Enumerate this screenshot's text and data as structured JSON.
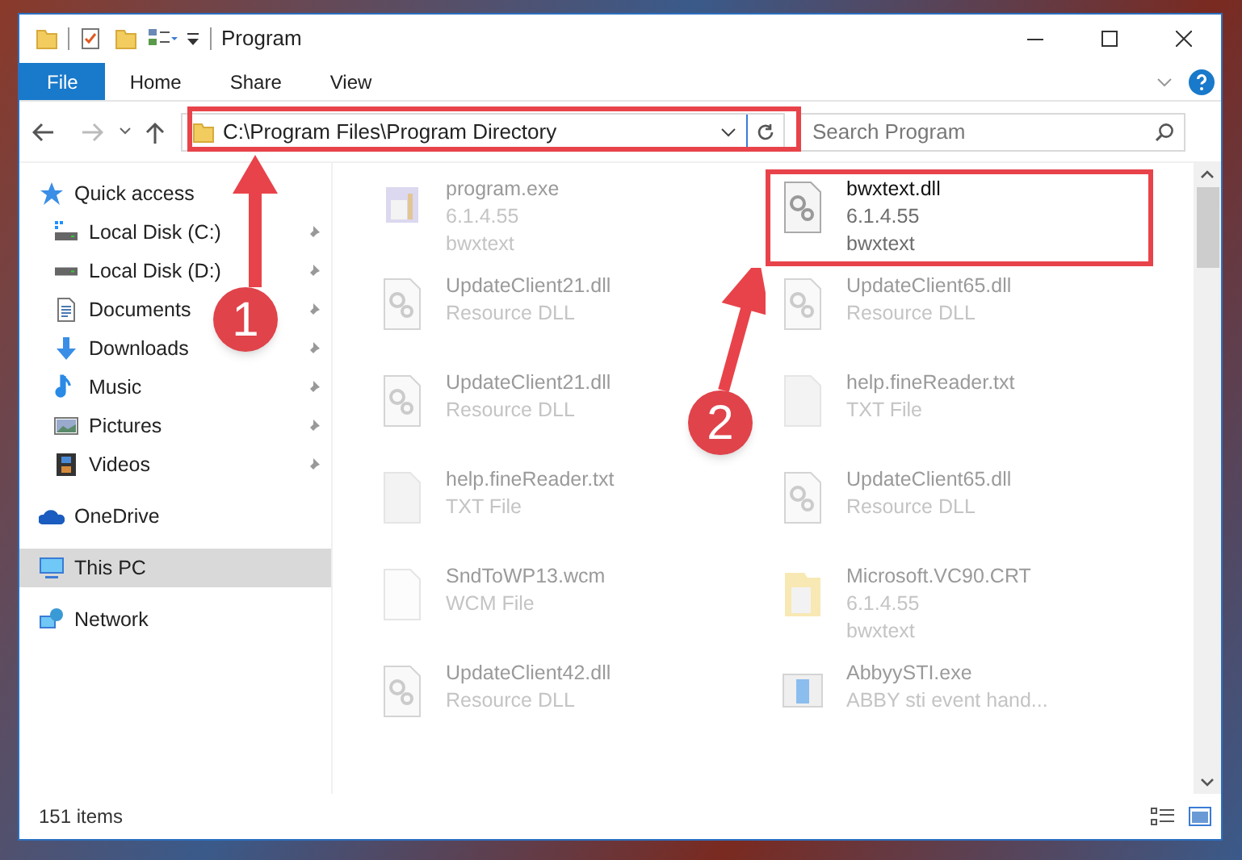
{
  "window": {
    "title": "Program"
  },
  "ribbon_tabs": [
    {
      "label": "File",
      "selected": true
    },
    {
      "label": "Home",
      "selected": false
    },
    {
      "label": "Share",
      "selected": false
    },
    {
      "label": "View",
      "selected": false
    }
  ],
  "address": "C:\\Program Files\\Program Directory",
  "search": {
    "placeholder": "Search Program"
  },
  "sidebar": {
    "items": [
      {
        "label": "Quick access",
        "kind": "star",
        "selected": false,
        "children": [
          {
            "label": "Local Disk (C:)",
            "kind": "disk-c",
            "pinned": true,
            "selected": false
          },
          {
            "label": "Local Disk (D:)",
            "kind": "disk",
            "pinned": true,
            "selected": false
          },
          {
            "label": "Documents",
            "kind": "documents",
            "pinned": true,
            "selected": false
          },
          {
            "label": "Downloads",
            "kind": "downloads",
            "pinned": true,
            "selected": false
          },
          {
            "label": "Music",
            "kind": "music",
            "pinned": true,
            "selected": false
          },
          {
            "label": "Pictures",
            "kind": "pictures",
            "pinned": true,
            "selected": false
          },
          {
            "label": "Videos",
            "kind": "videos",
            "pinned": true,
            "selected": false
          }
        ]
      },
      {
        "label": "OneDrive",
        "kind": "cloud",
        "selected": false
      },
      {
        "label": "This PC",
        "kind": "pc",
        "selected": true
      },
      {
        "label": "Network",
        "kind": "network",
        "selected": false
      }
    ]
  },
  "files": [
    {
      "name": "program.exe",
      "details": [
        "6.1.4.55",
        "bwxtext"
      ],
      "kind": "exe",
      "blurred": true
    },
    {
      "name": "bwxtext.dll",
      "details": [
        "6.1.4.55",
        "bwxtext"
      ],
      "kind": "dll",
      "blurred": false,
      "highlighted": true
    },
    {
      "name": "UpdateClient21.dll",
      "details": [
        "Resource DLL"
      ],
      "kind": "dll",
      "blurred": true
    },
    {
      "name": "UpdateClient65.dll",
      "details": [
        "Resource DLL"
      ],
      "kind": "dll",
      "blurred": true
    },
    {
      "name": "UpdateClient21.dll",
      "details": [
        "Resource DLL"
      ],
      "kind": "dll",
      "blurred": true
    },
    {
      "name": "help.fineReader.txt",
      "details": [
        "TXT File"
      ],
      "kind": "txt",
      "blurred": true
    },
    {
      "name": "help.fineReader.txt",
      "details": [
        "TXT File"
      ],
      "kind": "txt",
      "blurred": true
    },
    {
      "name": "UpdateClient65.dll",
      "details": [
        "Resource DLL"
      ],
      "kind": "dll",
      "blurred": true
    },
    {
      "name": "SndToWP13.wcm",
      "details": [
        "WCM File"
      ],
      "kind": "blank",
      "blurred": true
    },
    {
      "name": "Microsoft.VC90.CRT",
      "details": [
        "6.1.4.55",
        "bwxtext"
      ],
      "kind": "folder",
      "blurred": true
    },
    {
      "name": "UpdateClient42.dll",
      "details": [
        "Resource DLL"
      ],
      "kind": "dll",
      "blurred": true
    },
    {
      "name": "AbbyySTI.exe",
      "details": [
        "ABBY sti event hand..."
      ],
      "kind": "app",
      "blurred": true
    }
  ],
  "status_bar": {
    "text": "151 items"
  },
  "annotations": [
    {
      "label": "1"
    },
    {
      "label": "2"
    }
  ]
}
